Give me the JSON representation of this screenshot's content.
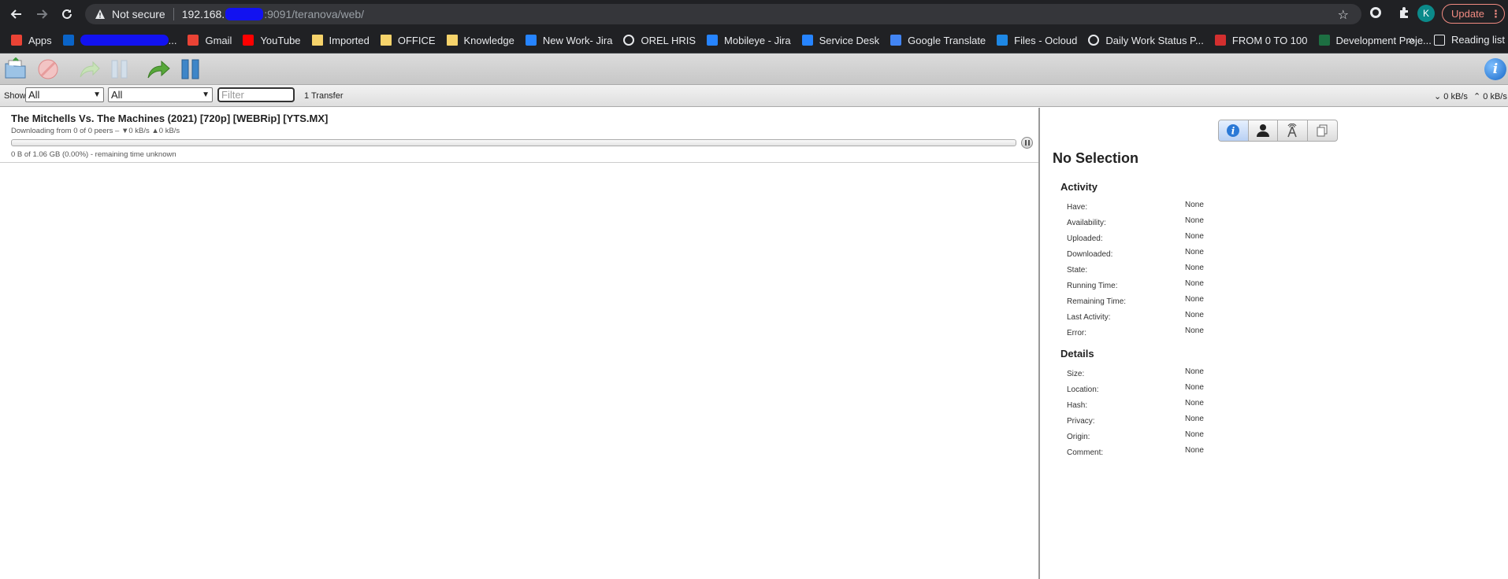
{
  "browser": {
    "security_label": "Not secure",
    "url_host_prefix": "192.168.",
    "url_rest": ":9091/teranova/web/",
    "profile_initial": "K",
    "update_label": "Update"
  },
  "bookmarks": [
    {
      "label": "Apps",
      "icon": "apps-grid-icon",
      "color": "#ea4335"
    },
    {
      "label": "...",
      "icon": "outlook-icon",
      "color": "#0a64c8",
      "redacted": true
    },
    {
      "label": "Gmail",
      "icon": "gmail-icon",
      "color": "#ea4335"
    },
    {
      "label": "YouTube",
      "icon": "youtube-icon",
      "color": "#ff0000"
    },
    {
      "label": "Imported",
      "icon": "folder-icon",
      "color": "#f6d36b"
    },
    {
      "label": "OFFICE",
      "icon": "folder-icon",
      "color": "#f6d36b"
    },
    {
      "label": "Knowledge",
      "icon": "folder-icon",
      "color": "#f6d36b"
    },
    {
      "label": "New Work- Jira",
      "icon": "jira-icon",
      "color": "#2684ff"
    },
    {
      "label": "OREL HRIS",
      "icon": "globe-icon",
      "color": "#e8eaed"
    },
    {
      "label": "Mobileye - Jira",
      "icon": "jira-icon",
      "color": "#2684ff"
    },
    {
      "label": "Service Desk",
      "icon": "service-desk-icon",
      "color": "#2684ff"
    },
    {
      "label": "Google Translate",
      "icon": "translate-icon",
      "color": "#4285f4"
    },
    {
      "label": "Files - Ocloud",
      "icon": "cloud-icon",
      "color": "#1e88e5"
    },
    {
      "label": "Daily Work Status P...",
      "icon": "globe-icon",
      "color": "#e8eaed"
    },
    {
      "label": "FROM 0 TO 100",
      "icon": "car-icon",
      "color": "#d32f2f"
    },
    {
      "label": "Development Proje...",
      "icon": "excel-icon",
      "color": "#1d6f42"
    }
  ],
  "bookmarks_more": "»",
  "reading_list": "Reading list",
  "toolbar": {
    "open_icon": "open-torrent-icon",
    "remove_icon": "remove-icon",
    "resume_icon": "resume-icon",
    "pause_icon": "pause-icon",
    "resume_all_icon": "resume-all-icon",
    "pause_all_icon": "pause-all-icon",
    "info_icon": "info-icon"
  },
  "filterbar": {
    "show_label": "Show",
    "state_filter": "All",
    "tracker_filter": "All",
    "filter_placeholder": "Filter",
    "transfer_count": "1 Transfer",
    "download_speed": "⌄ 0 kB/s",
    "upload_speed": "⌃ 0 kB/s"
  },
  "torrent": {
    "name": "The Mitchells Vs. The Machines (2021) [720p] [WEBRip] [YTS.MX]",
    "peers": "Downloading from 0 of 0 peers – ▼0 kB/s ▲0 kB/s",
    "progress_fraction": 0.0,
    "status": "0 B of 1.06 GB (0.00%) - remaining time unknown"
  },
  "inspector": {
    "title": "No Selection",
    "activity_title": "Activity",
    "activity": [
      {
        "label": "Have:",
        "value": "None"
      },
      {
        "label": "Availability:",
        "value": "None"
      },
      {
        "label": "Uploaded:",
        "value": "None"
      },
      {
        "label": "Downloaded:",
        "value": "None"
      },
      {
        "label": "State:",
        "value": "None"
      },
      {
        "label": "Running Time:",
        "value": "None"
      },
      {
        "label": "Remaining Time:",
        "value": "None"
      },
      {
        "label": "Last Activity:",
        "value": "None"
      },
      {
        "label": "Error:",
        "value": "None"
      }
    ],
    "details_title": "Details",
    "details": [
      {
        "label": "Size:",
        "value": "None"
      },
      {
        "label": "Location:",
        "value": "None"
      },
      {
        "label": "Hash:",
        "value": "None"
      },
      {
        "label": "Privacy:",
        "value": "None"
      },
      {
        "label": "Origin:",
        "value": "None"
      },
      {
        "label": "Comment:",
        "value": "None"
      }
    ],
    "tabs": [
      "info-tab-icon",
      "peers-tab-icon",
      "trackers-tab-icon",
      "files-tab-icon"
    ]
  }
}
